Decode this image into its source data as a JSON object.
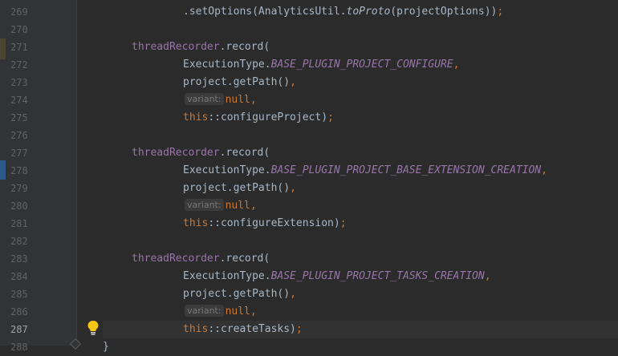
{
  "colors": {
    "background": "#2b2b2b",
    "gutter": "#313335",
    "field": "#9876aa",
    "keyword": "#cc7832",
    "text": "#a9b7c6",
    "line_number": "#606366",
    "bulb": "#f5c518"
  },
  "icons": {
    "bulb": "lightbulb-icon"
  },
  "editor": {
    "current_line": 287,
    "lines": [
      {
        "num": "269",
        "code": ".setOptions(AnalyticsUtil.toProto(projectOptions));"
      },
      {
        "num": "270",
        "code": ""
      },
      {
        "num": "271",
        "code": "threadRecorder.record("
      },
      {
        "num": "272",
        "code": "ExecutionType.BASE_PLUGIN_PROJECT_CONFIGURE,"
      },
      {
        "num": "273",
        "code": "project.getPath(),"
      },
      {
        "num": "274",
        "code": "null,",
        "hint": "variant:"
      },
      {
        "num": "275",
        "code": "this::configureProject);"
      },
      {
        "num": "276",
        "code": ""
      },
      {
        "num": "277",
        "code": "threadRecorder.record("
      },
      {
        "num": "278",
        "code": "ExecutionType.BASE_PLUGIN_PROJECT_BASE_EXTENSION_CREATION,"
      },
      {
        "num": "279",
        "code": "project.getPath(),"
      },
      {
        "num": "280",
        "code": "null,",
        "hint": "variant:"
      },
      {
        "num": "281",
        "code": "this::configureExtension);"
      },
      {
        "num": "282",
        "code": ""
      },
      {
        "num": "283",
        "code": "threadRecorder.record("
      },
      {
        "num": "284",
        "code": "ExecutionType.BASE_PLUGIN_PROJECT_TASKS_CREATION,"
      },
      {
        "num": "285",
        "code": "project.getPath(),"
      },
      {
        "num": "286",
        "code": "null,",
        "hint": "variant:"
      },
      {
        "num": "287",
        "code": "this::createTasks);"
      },
      {
        "num": "288",
        "code": "}"
      }
    ]
  }
}
